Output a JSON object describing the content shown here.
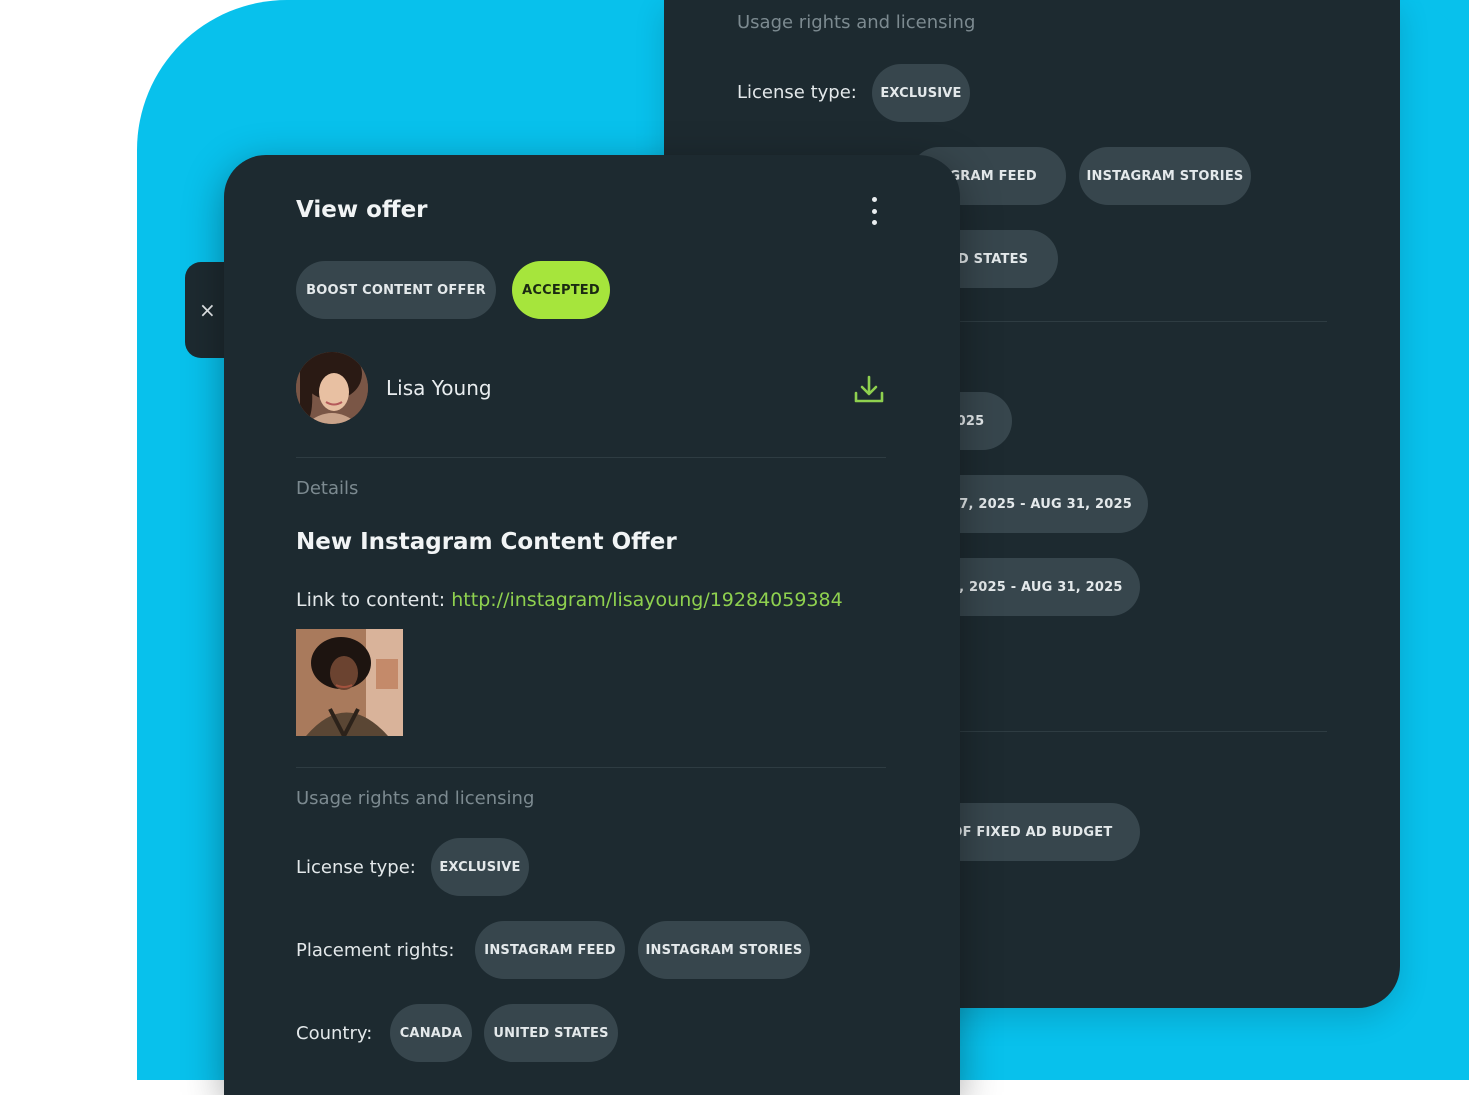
{
  "offer": {
    "title": "View offer",
    "type_badge": "BOOST CONTENT OFFER",
    "status_badge": "ACCEPTED",
    "close_label": "×",
    "creator": {
      "name": "Lisa Young"
    },
    "details_section": "Details",
    "offer_title": "New Instagram Content Offer",
    "link_label": "Link to content:",
    "link_url": "http://instagram/lisayoung/19284059384",
    "usage_section": "Usage rights and licensing",
    "license_type_label": "License type:",
    "license_type": "EXCLUSIVE",
    "placement_label": "Placement rights:",
    "placements": [
      "INSTAGRAM FEED",
      "INSTAGRAM STORIES"
    ],
    "country_label": "Country:",
    "countries": [
      "CANADA",
      "UNITED STATES"
    ]
  },
  "back_card": {
    "usage_section": "Usage rights and licensing",
    "license_type_label": "License type:",
    "license_type": "EXCLUSIVE",
    "placements": [
      "AGRAM FEED",
      "INSTAGRAM STORIES"
    ],
    "country": "TED STATES",
    "date_pill": ", 2025",
    "range_pill_1": "UL 17, 2025 - AUG 31, 2025",
    "range_pill_2": "L 17, 2025 - AUG 31, 2025",
    "budget_pill": "T OF FIXED AD BUDGET"
  },
  "colors": {
    "background_accent": "#08c1ec",
    "card": "#1d2a30",
    "pill": "#37464d",
    "accepted": "#a6e53c",
    "link": "#8fd14f"
  },
  "icons": [
    "close-icon",
    "more-vertical-icon",
    "download-icon"
  ]
}
